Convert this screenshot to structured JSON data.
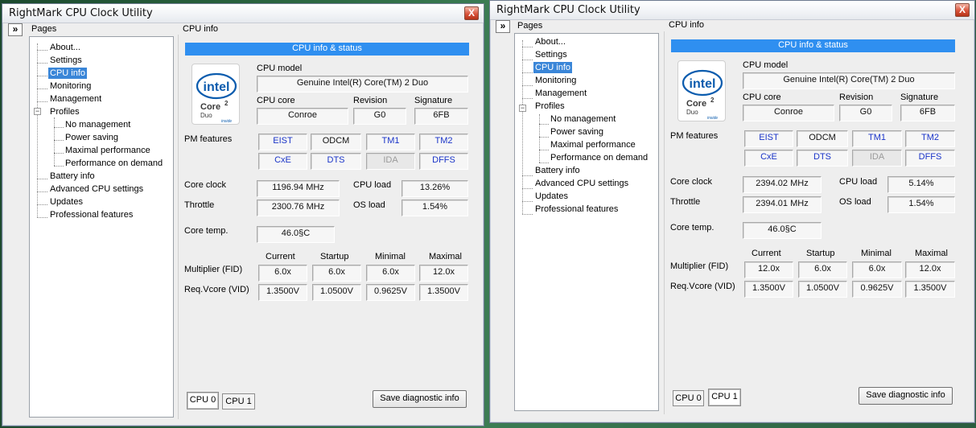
{
  "app_title": "RightMark CPU Clock Utility",
  "close_glyph": "X",
  "pages_label": "Pages",
  "collapse_glyph": "»",
  "section_title": "CPU info",
  "banner": "CPU info & status",
  "logo": {
    "brand": "intel",
    "product": "Core",
    "superscript": "2",
    "sub": "Duo",
    "tag": "inside"
  },
  "labels": {
    "cpu_model": "CPU model",
    "cpu_core": "CPU core",
    "revision": "Revision",
    "signature": "Signature",
    "pm_features": "PM features",
    "core_clock": "Core clock",
    "throttle": "Throttle",
    "cpu_load": "CPU load",
    "os_load": "OS load",
    "core_temp": "Core temp.",
    "current": "Current",
    "startup": "Startup",
    "minimal": "Minimal",
    "maximal": "Maximal",
    "multiplier": "Multiplier (FID)",
    "vcore": "Req.Vcore (VID)"
  },
  "nav": [
    {
      "label": "About..."
    },
    {
      "label": "Settings"
    },
    {
      "label": "CPU info"
    },
    {
      "label": "Monitoring"
    },
    {
      "label": "Management"
    },
    {
      "label": "Profiles"
    },
    {
      "label": "No management"
    },
    {
      "label": "Power saving"
    },
    {
      "label": "Maximal performance"
    },
    {
      "label": "Performance on demand"
    },
    {
      "label": "Battery info"
    },
    {
      "label": "Advanced CPU settings"
    },
    {
      "label": "Updates"
    },
    {
      "label": "Professional features"
    }
  ],
  "expander_glyph": "−",
  "features": [
    "EIST",
    "ODCM",
    "TM1",
    "TM2",
    "CxE",
    "DTS",
    "IDA",
    "DFFS"
  ],
  "save_label": "Save diagnostic info",
  "cpu_tabs": [
    "CPU 0",
    "CPU 1"
  ],
  "windows": [
    {
      "cpu_model": "Genuine Intel(R) Core(TM) 2 Duo",
      "cpu_core": "Conroe",
      "revision": "G0",
      "signature": "6FB",
      "core_clock": "1196.94 MHz",
      "throttle": "2300.76 MHz",
      "cpu_load": "13.26%",
      "os_load": "1.54%",
      "core_temp": "46.0§C",
      "multiplier": [
        "6.0x",
        "6.0x",
        "6.0x",
        "12.0x"
      ],
      "vcore": [
        "1.3500V",
        "1.0500V",
        "0.9625V",
        "1.3500V"
      ],
      "active_tab": 0
    },
    {
      "cpu_model": "Genuine Intel(R) Core(TM) 2 Duo",
      "cpu_core": "Conroe",
      "revision": "G0",
      "signature": "6FB",
      "core_clock": "2394.02 MHz",
      "throttle": "2394.01 MHz",
      "cpu_load": "5.14%",
      "os_load": "1.54%",
      "core_temp": "46.0§C",
      "multiplier": [
        "12.0x",
        "6.0x",
        "6.0x",
        "12.0x"
      ],
      "vcore": [
        "1.3500V",
        "1.0500V",
        "0.9625V",
        "1.3500V"
      ],
      "active_tab": 1
    }
  ],
  "colors": {
    "banner": "#2f8ff0",
    "selection": "#3a86d8",
    "feature_text": "#1a34c8",
    "feature_disabled": "#9a9a9a"
  }
}
